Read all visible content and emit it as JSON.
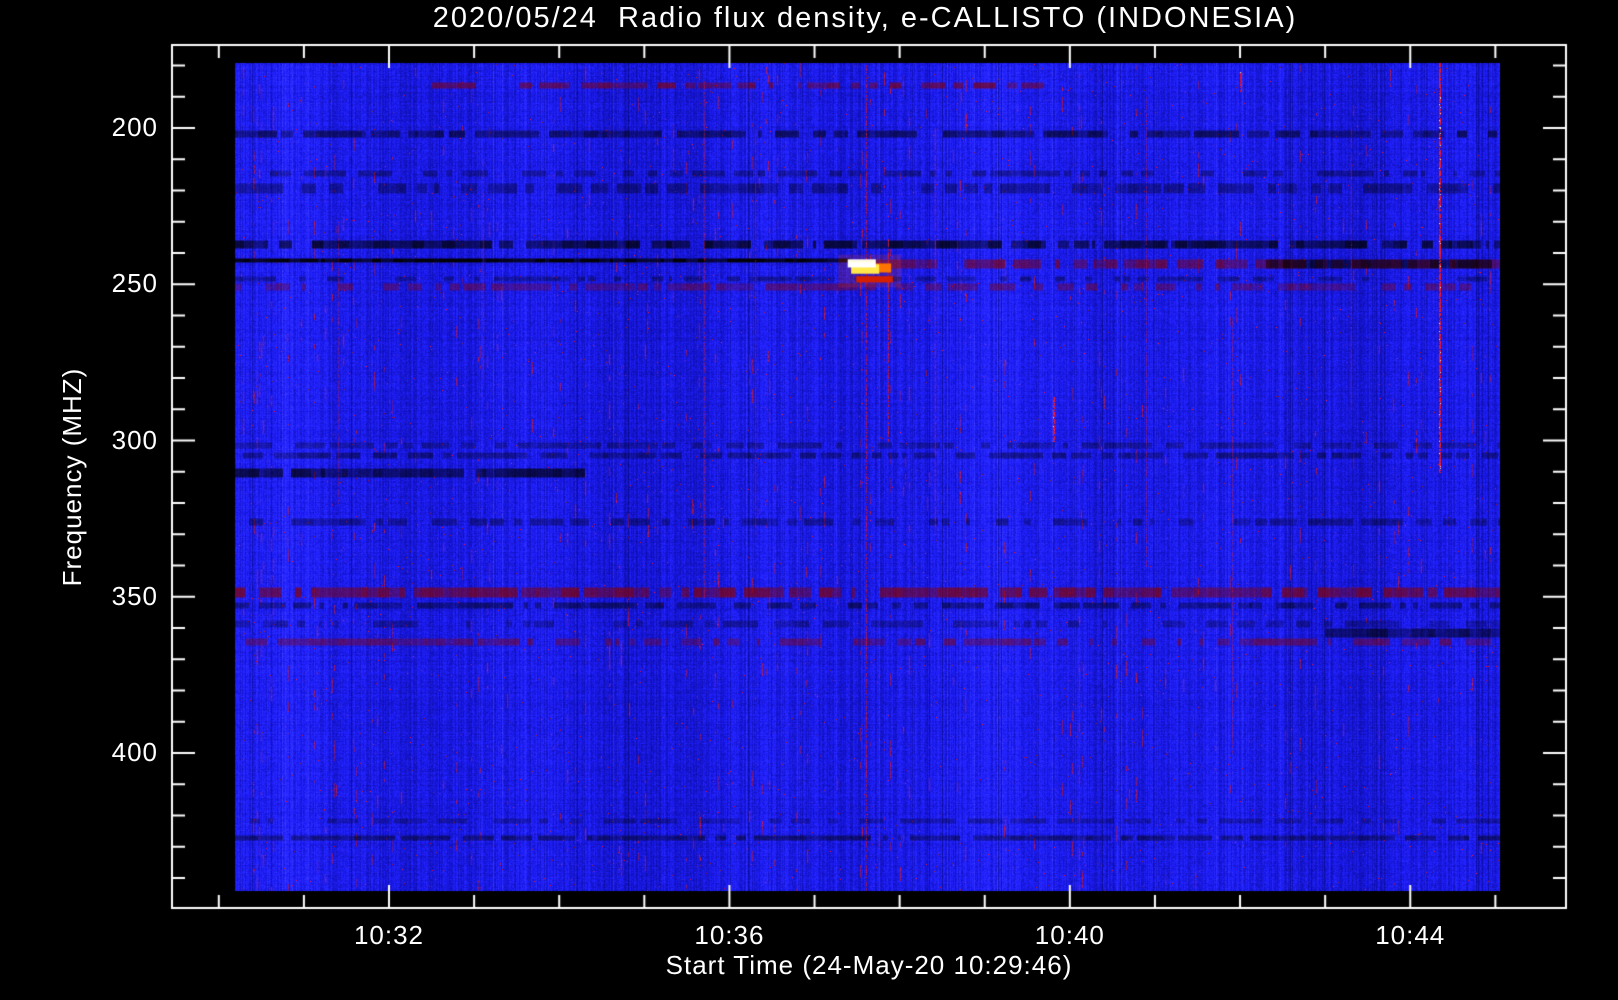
{
  "chart_data": {
    "type": "heatmap",
    "title": "2020/05/24  Radio flux density, e-CALLISTO (INDONESIA)",
    "xlabel": "Start Time (24-May-20 10:29:46)",
    "ylabel": "Frequency (MHZ)",
    "x_axis": {
      "unit": "time UT (minutes after 10:00)",
      "axis_range_minutes": [
        29.45,
        45.83
      ],
      "data_range_minutes": [
        30.19,
        45.05
      ],
      "major_ticks": [
        {
          "minute": 32,
          "label": "10:32"
        },
        {
          "minute": 36,
          "label": "10:36"
        },
        {
          "minute": 40,
          "label": "10:40"
        },
        {
          "minute": 44,
          "label": "10:44"
        }
      ],
      "minor_tick_step_minutes": 1
    },
    "y_axis": {
      "unit": "MHz",
      "axis_range_mhz": [
        173.4,
        449.6
      ],
      "data_range_mhz": [
        179.2,
        444.2
      ],
      "major_ticks": [
        200,
        250,
        300,
        350,
        400
      ],
      "minor_tick_step_mhz": 10,
      "direction": "increasing-downward"
    },
    "colors": {
      "page_background": "#000000",
      "axis": "#ffffff",
      "quiet_sun_background": "#2020e4",
      "rfi_dark": "#000014",
      "speckle_red": "#cc1d10",
      "burst_core": "#ffffff",
      "burst_mid": "#ffe94a",
      "burst_tip": "#ff7300",
      "burst_tail": "#d42000"
    },
    "burst": {
      "description": "saturated solar radio burst near 245 MHz at ~10:37.5",
      "halo": {
        "t": [
          37.28,
          38.02
        ],
        "f": [
          240.5,
          251.0
        ]
      },
      "tail": {
        "t": [
          37.49,
          37.92
        ],
        "f": [
          247.4,
          249.4
        ]
      },
      "tip": {
        "t": [
          37.7,
          37.9
        ],
        "f": [
          243.3,
          246.2
        ]
      },
      "mid": {
        "t": [
          37.43,
          37.76
        ],
        "f": [
          243.6,
          246.6
        ]
      },
      "core": {
        "t": [
          37.39,
          37.72
        ],
        "f": [
          242.0,
          244.6
        ]
      },
      "pre_burst_absorption_line": {
        "t": [
          30.19,
          37.42
        ],
        "f": [
          241.6,
          242.9
        ]
      }
    },
    "rfi_bands": [
      {
        "f": [
          185.2,
          187.2
        ],
        "t": [
          32.5,
          39.7
        ],
        "s": 0.5,
        "density": 0.6,
        "tint": "red"
      },
      {
        "f": [
          200.6,
          202.8
        ],
        "t": [
          30.19,
          45.05
        ],
        "s": 0.45,
        "density": 0.75
      },
      {
        "f": [
          213.4,
          215.3
        ],
        "t": [
          30.19,
          45.05
        ],
        "s": 0.3,
        "density": 0.6
      },
      {
        "f": [
          217.6,
          220.8
        ],
        "t": [
          30.19,
          45.05
        ],
        "s": 0.32,
        "density": 0.65
      },
      {
        "f": [
          235.8,
          238.4
        ],
        "t": [
          30.19,
          45.05
        ],
        "s": 0.6,
        "density": 0.85
      },
      {
        "f": [
          241.6,
          242.9
        ],
        "t": [
          30.19,
          37.42
        ],
        "s": 0.95,
        "density": 1.0
      },
      {
        "f": [
          242.0,
          244.8
        ],
        "t": [
          37.6,
          45.05
        ],
        "s": 0.5,
        "density": 0.8,
        "tint": "red"
      },
      {
        "f": [
          242.0,
          244.8
        ],
        "t": [
          42.3,
          45.05
        ],
        "s": 0.55,
        "density": 0.9
      },
      {
        "f": [
          247.3,
          248.9
        ],
        "t": [
          30.19,
          45.05
        ],
        "s": 0.3,
        "density": 0.55
      },
      {
        "f": [
          249.6,
          251.8
        ],
        "t": [
          30.19,
          45.05
        ],
        "s": 0.35,
        "density": 0.7,
        "tint": "red"
      },
      {
        "f": [
          300.5,
          302.4
        ],
        "t": [
          30.19,
          45.05
        ],
        "s": 0.28,
        "density": 0.6
      },
      {
        "f": [
          303.7,
          305.6
        ],
        "t": [
          30.19,
          45.05
        ],
        "s": 0.35,
        "density": 0.7
      },
      {
        "f": [
          308.8,
          311.7
        ],
        "t": [
          30.19,
          34.3
        ],
        "s": 0.55,
        "density": 0.95
      },
      {
        "f": [
          324.8,
          327.1
        ],
        "t": [
          30.19,
          45.05
        ],
        "s": 0.3,
        "density": 0.6
      },
      {
        "f": [
          346.9,
          350.1
        ],
        "t": [
          30.19,
          45.05
        ],
        "s": 0.55,
        "density": 0.85,
        "tint": "red"
      },
      {
        "f": [
          351.7,
          353.6
        ],
        "t": [
          30.19,
          45.05
        ],
        "s": 0.4,
        "density": 0.7
      },
      {
        "f": [
          357.5,
          359.7
        ],
        "t": [
          30.19,
          45.05
        ],
        "s": 0.25,
        "density": 0.5
      },
      {
        "f": [
          363.2,
          365.5
        ],
        "t": [
          30.19,
          45.05
        ],
        "s": 0.4,
        "density": 0.7,
        "tint": "red"
      },
      {
        "f": [
          360.0,
          363.0
        ],
        "t": [
          43.0,
          45.05
        ],
        "s": 0.5,
        "density": 0.9
      },
      {
        "f": [
          420.8,
          422.4
        ],
        "t": [
          30.19,
          45.05
        ],
        "s": 0.25,
        "density": 0.55
      },
      {
        "f": [
          426.2,
          427.8
        ],
        "t": [
          30.19,
          45.05
        ],
        "s": 0.4,
        "density": 0.75
      }
    ],
    "red_lines": [
      {
        "minute": 37.61,
        "f": [
          179,
          444
        ],
        "s": 0.75
      },
      {
        "minute": 37.86,
        "f": [
          235,
          300
        ],
        "s": 0.9
      },
      {
        "minute": 38.42,
        "f": [
          200,
          330
        ],
        "s": 0.7
      },
      {
        "minute": 44.34,
        "f": [
          179,
          310
        ],
        "s": 1.0,
        "bright": true
      },
      {
        "minute": 39.8,
        "f": [
          286,
          300
        ],
        "s": 1.0,
        "bright": true
      },
      {
        "minute": 33.1,
        "f": [
          210,
          280
        ],
        "s": 0.5
      },
      {
        "minute": 35.7,
        "f": [
          185,
          350
        ],
        "s": 0.5
      },
      {
        "minute": 36.3,
        "f": [
          200,
          330
        ],
        "s": 0.45
      },
      {
        "minute": 40.9,
        "f": [
          190,
          340
        ],
        "s": 0.5
      },
      {
        "minute": 41.9,
        "f": [
          260,
          400
        ],
        "s": 0.45
      },
      {
        "minute": 31.4,
        "f": [
          230,
          320
        ],
        "s": 0.4
      },
      {
        "minute": 43.3,
        "f": [
          200,
          290
        ],
        "s": 0.45
      },
      {
        "minute": 42.0,
        "f": [
          182,
          188
        ],
        "s": 0.9,
        "bright": true
      }
    ],
    "noise": {
      "seed": 42,
      "speckle_columns": 170,
      "speckle_pixel_probability": 0.0025
    }
  }
}
